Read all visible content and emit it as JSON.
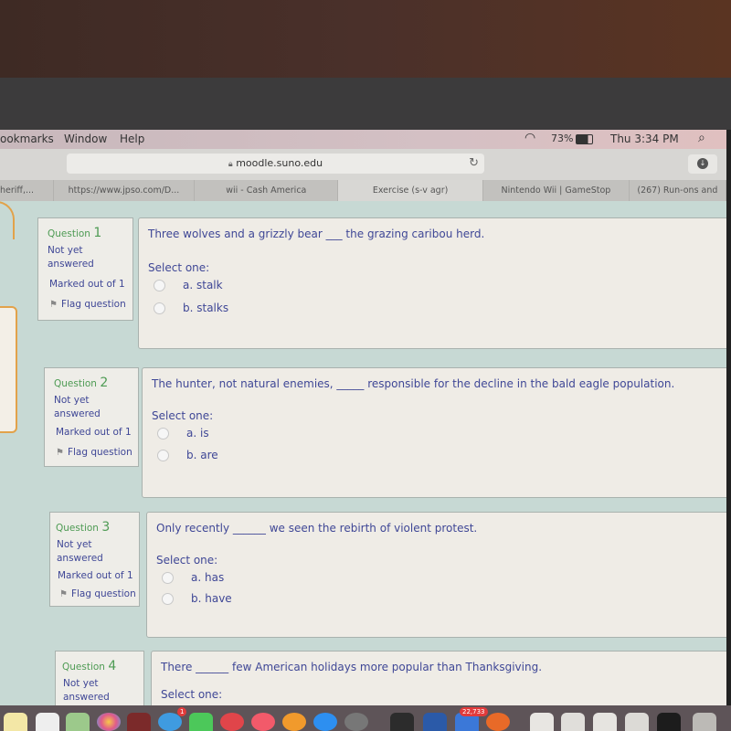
{
  "menubar": {
    "items": [
      "ookmarks",
      "Window",
      "Help"
    ],
    "battery": "73%",
    "clock": "Thu 3:34 PM",
    "icons": [
      "wifi-icon",
      "battery-icon",
      "spotlight-search-icon"
    ]
  },
  "toolbar": {
    "url": "moodle.suno.edu",
    "lock_icon": "lock-icon",
    "reload_icon": "reload-icon",
    "download_icon": "download-icon"
  },
  "tabs": [
    {
      "label": "heriff,...",
      "active": false
    },
    {
      "label": "https://www.jpso.com/D...",
      "active": false
    },
    {
      "label": "wii - Cash America",
      "active": false
    },
    {
      "label": "Exercise (s-v agr)",
      "active": true
    },
    {
      "label": "Nintendo Wii | GameStop",
      "active": false
    },
    {
      "label": "(267) Run-ons and",
      "active": false
    }
  ],
  "quiz": {
    "select_label": "Select one:",
    "questions": [
      {
        "label": "Question",
        "number": "1",
        "state": "Not yet answered",
        "marked": "Marked out of 1",
        "flag": "Flag question",
        "text": "Three wolves and a grizzly bear ___ the grazing caribou herd.",
        "options": [
          "a. stalk",
          "b. stalks"
        ]
      },
      {
        "label": "Question",
        "number": "2",
        "state": "Not yet answered",
        "marked": "Marked out of 1",
        "flag": "Flag question",
        "text": "The hunter, not natural enemies, _____ responsible for the decline in the bald eagle population.",
        "options": [
          "a. is",
          "b. are"
        ]
      },
      {
        "label": "Question",
        "number": "3",
        "state": "Not yet answered",
        "marked": "Marked out of 1",
        "flag": "Flag question",
        "text": "Only recently ______ we seen the rebirth of violent protest.",
        "options": [
          "a. has",
          "b. have"
        ]
      },
      {
        "label": "Question",
        "number": "4",
        "state": "Not yet answered",
        "text": "There ______ few American holidays more popular than Thanksgiving.",
        "options": []
      }
    ]
  },
  "dock": {
    "badges": {
      "messages": "1",
      "mail": "22,733"
    }
  },
  "colors": {
    "question_text": "#3f4796",
    "question_number": "#4e9b54",
    "page_bg": "#c7d9d4",
    "accent_orange": "#e2a24a"
  }
}
